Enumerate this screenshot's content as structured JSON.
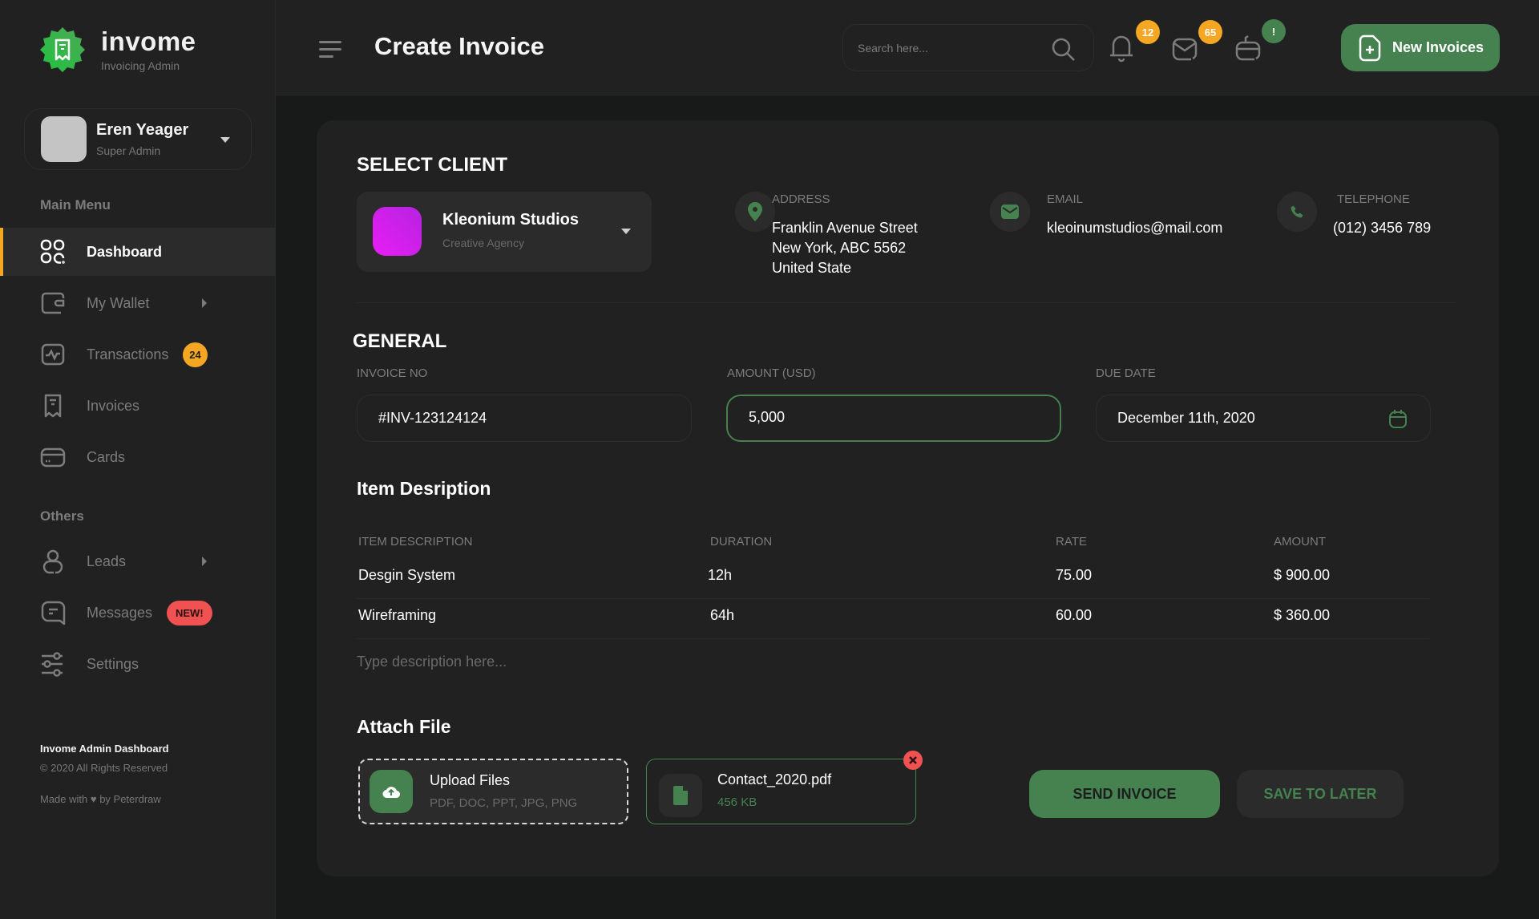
{
  "brand": {
    "name": "invome",
    "subtitle": "Invoicing Admin",
    "color": "#2ebd4e"
  },
  "profile": {
    "name": "Eren Yeager",
    "role": "Super Admin"
  },
  "sidebar": {
    "main_heading": "Main Menu",
    "main_items": [
      {
        "label": "Dashboard",
        "icon": "dashboard-grid-icon",
        "active": true
      },
      {
        "label": "My Wallet",
        "icon": "wallet-icon",
        "has_submenu": true
      },
      {
        "label": "Transactions",
        "icon": "activity-icon",
        "badge": "24"
      },
      {
        "label": "Invoices",
        "icon": "receipt-icon"
      },
      {
        "label": "Cards",
        "icon": "credit-card-icon"
      }
    ],
    "others_heading": "Others",
    "other_items": [
      {
        "label": "Leads",
        "icon": "user-icon",
        "has_submenu": true
      },
      {
        "label": "Messages",
        "icon": "chat-icon",
        "badge": "NEW!"
      },
      {
        "label": "Settings",
        "icon": "sliders-icon"
      }
    ],
    "footer": {
      "title": "Invome Admin Dashboard",
      "copyright": "© 2020 All Rights Reserved",
      "made_with": "Made with ♥ by Peterdraw"
    }
  },
  "header": {
    "title": "Create Invoice",
    "search_placeholder": "Search here...",
    "notifications": [
      {
        "icon": "bell-icon",
        "count": "12",
        "color": "#f5a623"
      },
      {
        "icon": "mail-icon",
        "count": "65",
        "color": "#f5a623"
      },
      {
        "icon": "basket-icon",
        "count": "!",
        "color": "#458250"
      }
    ],
    "new_button": "New Invoices"
  },
  "client": {
    "section_title": "SELECT CLIENT",
    "name": "Kleonium Studios",
    "type": "Creative Agency",
    "address_label": "ADDRESS",
    "address_lines": [
      "Franklin Avenue Street",
      "New York, ABC 5562",
      "United State"
    ],
    "email_label": "EMAIL",
    "email": "kleoinumstudios@mail.com",
    "phone_label": "TELEPHONE",
    "phone": "(012) 3456 789"
  },
  "general": {
    "section_title": "GENERAL",
    "invoice_no_label": "INVOICE NO",
    "invoice_no": "#INV-123124124",
    "amount_label": "AMOUNT (USD)",
    "amount": "5,000",
    "due_date_label": "DUE DATE",
    "due_date": "December 11th, 2020"
  },
  "items": {
    "section_title": "Item Desription",
    "columns": [
      "ITEM DESCRIPTION",
      "DURATION",
      "RATE",
      "AMOUNT"
    ],
    "rows": [
      [
        "Desgin System",
        "12h",
        "75.00",
        "$ 900.00"
      ],
      [
        "Wireframing",
        "64h",
        "60.00",
        "$ 360.00"
      ]
    ],
    "description_placeholder": "Type description here..."
  },
  "attach": {
    "section_title": "Attach File",
    "upload_title": "Upload Files",
    "upload_formats": "PDF, DOC, PPT, JPG, PNG",
    "file_name": "Contact_2020.pdf",
    "file_size": "456 KB"
  },
  "actions": {
    "send": "SEND INVOICE",
    "save": "SAVE TO LATER"
  },
  "colors": {
    "accent": "#458250",
    "warning": "#f5a623",
    "danger": "#f05252",
    "panel": "#212121",
    "background": "#181a1a"
  }
}
